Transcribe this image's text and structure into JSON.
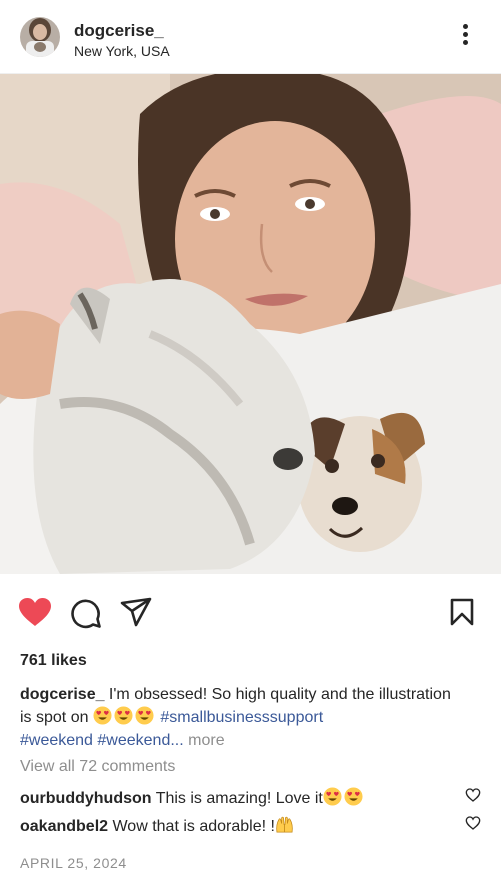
{
  "header": {
    "username": "dogcerise_",
    "location": "New York, USA"
  },
  "post": {
    "likes": "761 likes",
    "caption_user": "dogcerise_",
    "caption_text_1": " I'm obsessed! So high quality and the illustration is spot on ",
    "hashtag_1": "#smallbusinesssupport",
    "hashtag_2": "#weekend",
    "hashtag_3": "#weekend...",
    "more": "more",
    "view_all": "View all 72 comments",
    "date": "APRIL 25, 2024"
  },
  "comments": [
    {
      "user": "ourbuddyhudson",
      "text": "This is amazing! Love it"
    },
    {
      "user": "oakandbel2",
      "text": "Wow that is adorable! !"
    }
  ],
  "colors": {
    "like_red": "#ed4956",
    "hashtag_blue": "#3b5998",
    "muted_gray": "#8e8e8e",
    "text_dark": "#262626"
  },
  "icons": [
    "more-vertical-icon",
    "heart-filled-icon",
    "comment-icon",
    "share-icon",
    "bookmark-icon",
    "heart-outline-icon",
    "heart-eyes-emoji",
    "raising-hands-emoji"
  ]
}
